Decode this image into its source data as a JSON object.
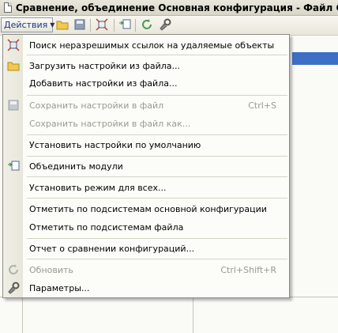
{
  "window": {
    "title": "Сравнение, объединение Основная конфигурация - Файл C:\\Users\\"
  },
  "toolbar": {
    "actions_label": "Действия"
  },
  "menu": {
    "items": [
      {
        "label": "Поиск неразрешимых ссылок на удаляемые объекты",
        "shortcut": "",
        "icon": "search-links-icon",
        "enabled": true
      },
      {
        "label": "Загрузить настройки из файла...",
        "shortcut": "",
        "icon": "open-folder-icon",
        "enabled": true
      },
      {
        "label": "Добавить настройки из файла...",
        "shortcut": "",
        "icon": "",
        "enabled": true
      },
      {
        "label": "Сохранить настройки в файл",
        "shortcut": "Ctrl+S",
        "icon": "save-icon",
        "enabled": false
      },
      {
        "label": "Сохранить настройки в файл как...",
        "shortcut": "",
        "icon": "",
        "enabled": false
      },
      {
        "label": "Установить настройки по умолчанию",
        "shortcut": "",
        "icon": "",
        "enabled": true
      },
      {
        "label": "Объединить модули",
        "shortcut": "",
        "icon": "merge-modules-icon",
        "enabled": true
      },
      {
        "label": "Установить режим для всех...",
        "shortcut": "",
        "icon": "",
        "enabled": true
      },
      {
        "label": "Отметить по подсистемам основной конфигурации",
        "shortcut": "",
        "icon": "",
        "enabled": true
      },
      {
        "label": "Отметить по подсистемам файла",
        "shortcut": "",
        "icon": "",
        "enabled": true
      },
      {
        "label": "Отчет о сравнении конфигураций...",
        "shortcut": "",
        "icon": "",
        "enabled": true
      },
      {
        "label": "Обновить",
        "shortcut": "Ctrl+Shift+R",
        "icon": "refresh-icon",
        "enabled": false
      },
      {
        "label": "Параметры...",
        "shortcut": "",
        "icon": "wrench-icon",
        "enabled": true
      }
    ]
  }
}
